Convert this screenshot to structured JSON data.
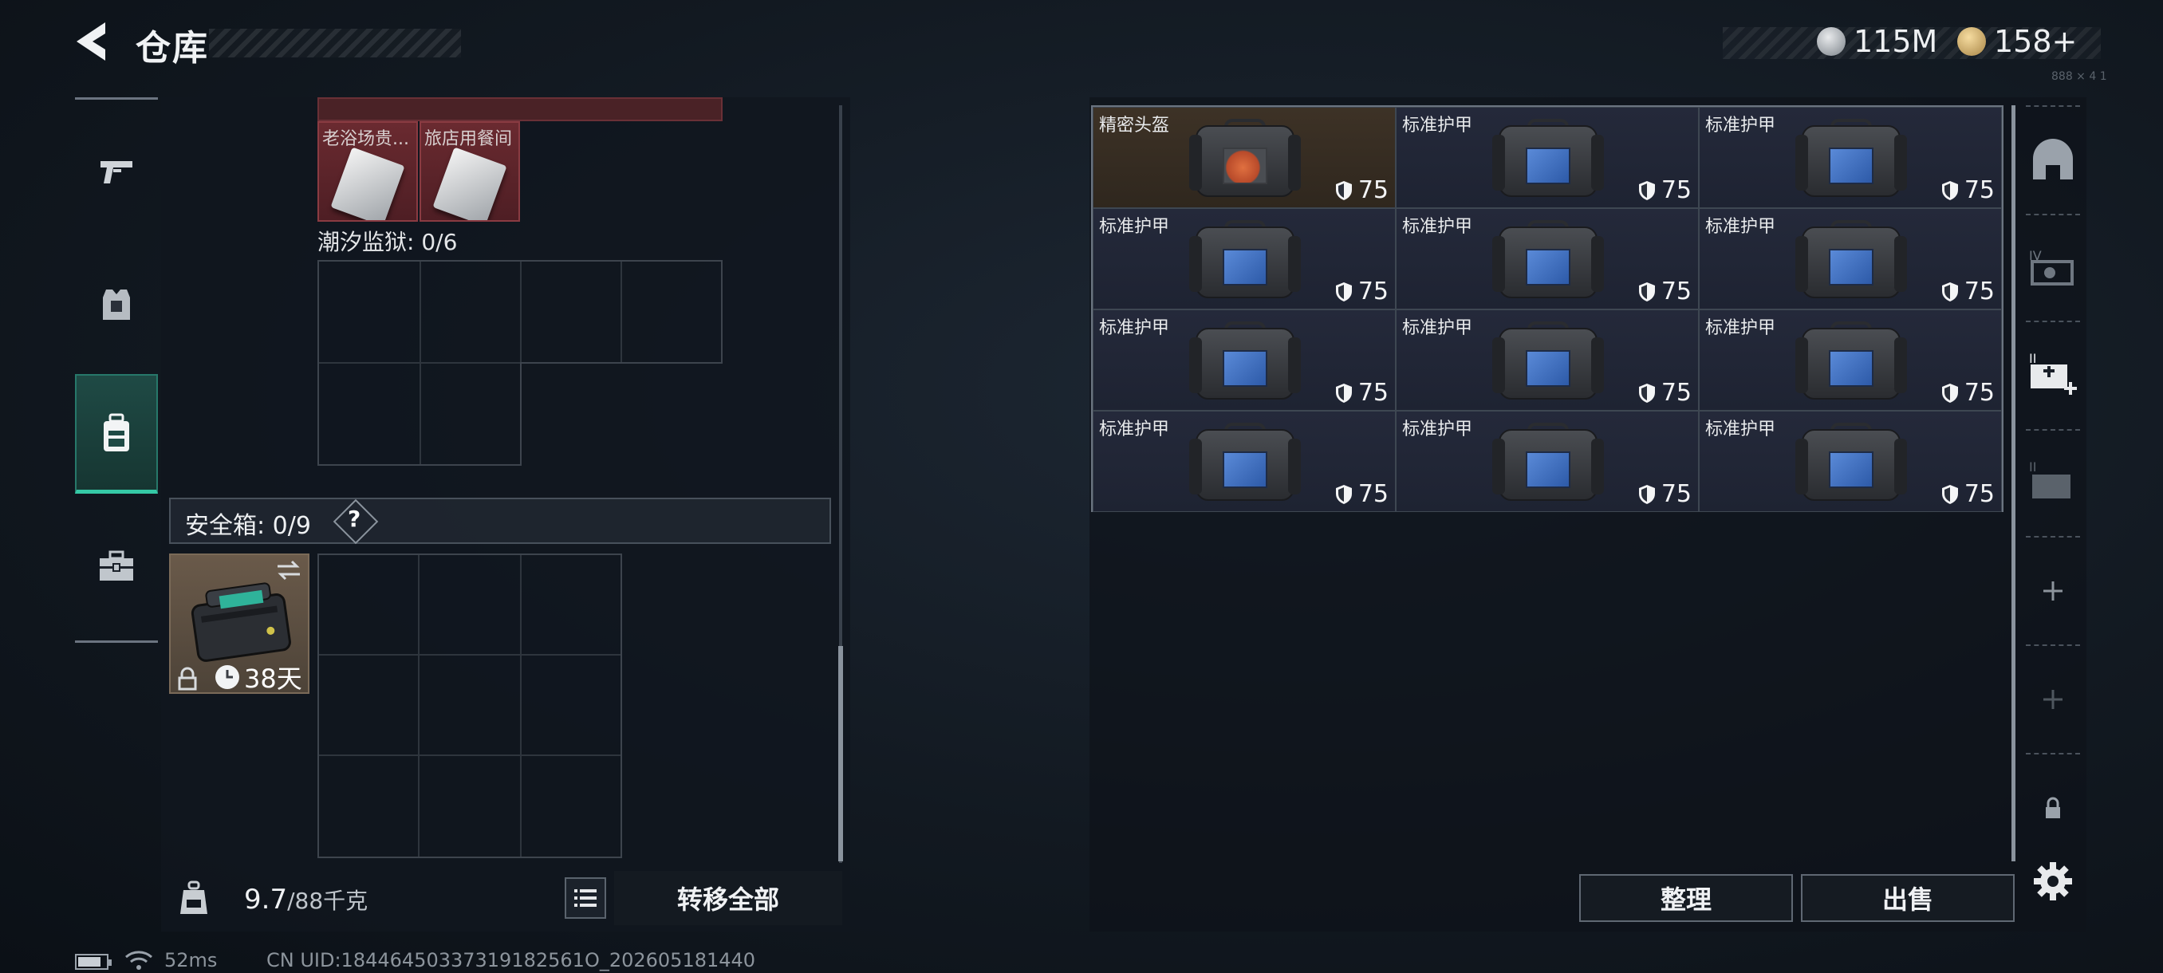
{
  "header": {
    "title": "仓库",
    "back_icon": "back-arrow-icon",
    "currency_silver": "115M",
    "currency_gold": "158+",
    "silver_icon": "silver-coin-icon",
    "gold_icon": "gold-coin-icon",
    "corner_note": "888 × 4 1"
  },
  "left_tabs": [
    {
      "name": "weapons",
      "icon": "pistol-icon"
    },
    {
      "name": "armor",
      "icon": "armor-vest-icon"
    },
    {
      "name": "backpack",
      "icon": "backpack-icon",
      "active": true
    },
    {
      "name": "toolbox",
      "icon": "toolbox-icon"
    }
  ],
  "container": {
    "cards": [
      {
        "label": "老浴场贵..."
      },
      {
        "label": "旅店用餐间"
      }
    ],
    "tide_label": "潮汐监狱: 0/6"
  },
  "safebox": {
    "label": "安全箱: 0/9",
    "help": "?",
    "days": "38天",
    "swap_icon": "swap-arrows-icon",
    "lock_icon": "lock-icon",
    "clock_icon": "clock-icon"
  },
  "bottom_bar": {
    "weight_value": "9.7",
    "weight_max": "/88千克",
    "weight_icon": "weight-kg-icon",
    "list_icon": "list-icon",
    "transfer_all": "转移全部"
  },
  "stash": {
    "items": [
      {
        "name": "精密头盔",
        "durability": "75",
        "rarity": "gold"
      },
      {
        "name": "标准护甲",
        "durability": "75",
        "rarity": "purple"
      },
      {
        "name": "标准护甲",
        "durability": "75",
        "rarity": "purple"
      },
      {
        "name": "标准护甲",
        "durability": "75",
        "rarity": "purple"
      },
      {
        "name": "标准护甲",
        "durability": "75",
        "rarity": "purple"
      },
      {
        "name": "标准护甲",
        "durability": "75",
        "rarity": "purple"
      },
      {
        "name": "标准护甲",
        "durability": "75",
        "rarity": "purple"
      },
      {
        "name": "标准护甲",
        "durability": "75",
        "rarity": "purple"
      },
      {
        "name": "标准护甲",
        "durability": "75",
        "rarity": "purple"
      },
      {
        "name": "标准护甲",
        "durability": "75",
        "rarity": "purple"
      },
      {
        "name": "标准护甲",
        "durability": "75",
        "rarity": "purple"
      },
      {
        "name": "标准护甲",
        "durability": "75",
        "rarity": "purple"
      }
    ],
    "organize": "整理",
    "sell": "出售"
  },
  "right_toolbar": [
    {
      "icon": "helmet-icon"
    },
    {
      "icon": "iv-case-icon"
    },
    {
      "icon": "medkit-plus-icon"
    },
    {
      "icon": "ammo-case-icon"
    },
    {
      "icon": "plus-icon"
    },
    {
      "icon": "plus-icon-dim"
    },
    {
      "icon": "lock-icon"
    },
    {
      "icon": "gear-icon"
    }
  ],
  "footer": {
    "ping": "52ms",
    "uid": "CN UID:18446450337319182561O_202605181440"
  },
  "colors": {
    "accent_teal": "#35c9a6",
    "gold_rarity": "#3d3226",
    "armor_plate_blue": "#4a7ad0"
  }
}
